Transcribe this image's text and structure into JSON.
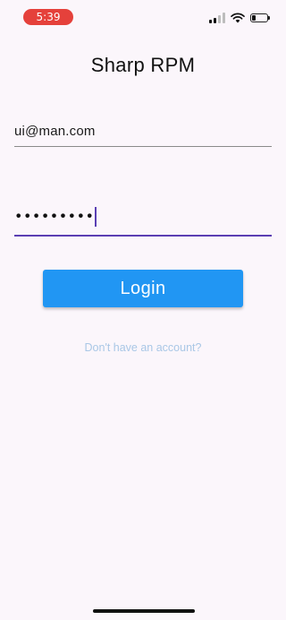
{
  "status_bar": {
    "time": "5:39",
    "signal_bars": 2,
    "battery_level": 0.2
  },
  "app": {
    "title": "Sharp RPM"
  },
  "login_form": {
    "email_value": "ui@man.com",
    "password_masked": "•••••••••",
    "login_label": "Login",
    "signup_link": "Don't have an account?"
  },
  "colors": {
    "background": "#fbf6fb",
    "time_pill": "#e5413b",
    "button": "#2196f3",
    "focused_underline": "#5a3fb3",
    "link": "#a9c7e6"
  }
}
